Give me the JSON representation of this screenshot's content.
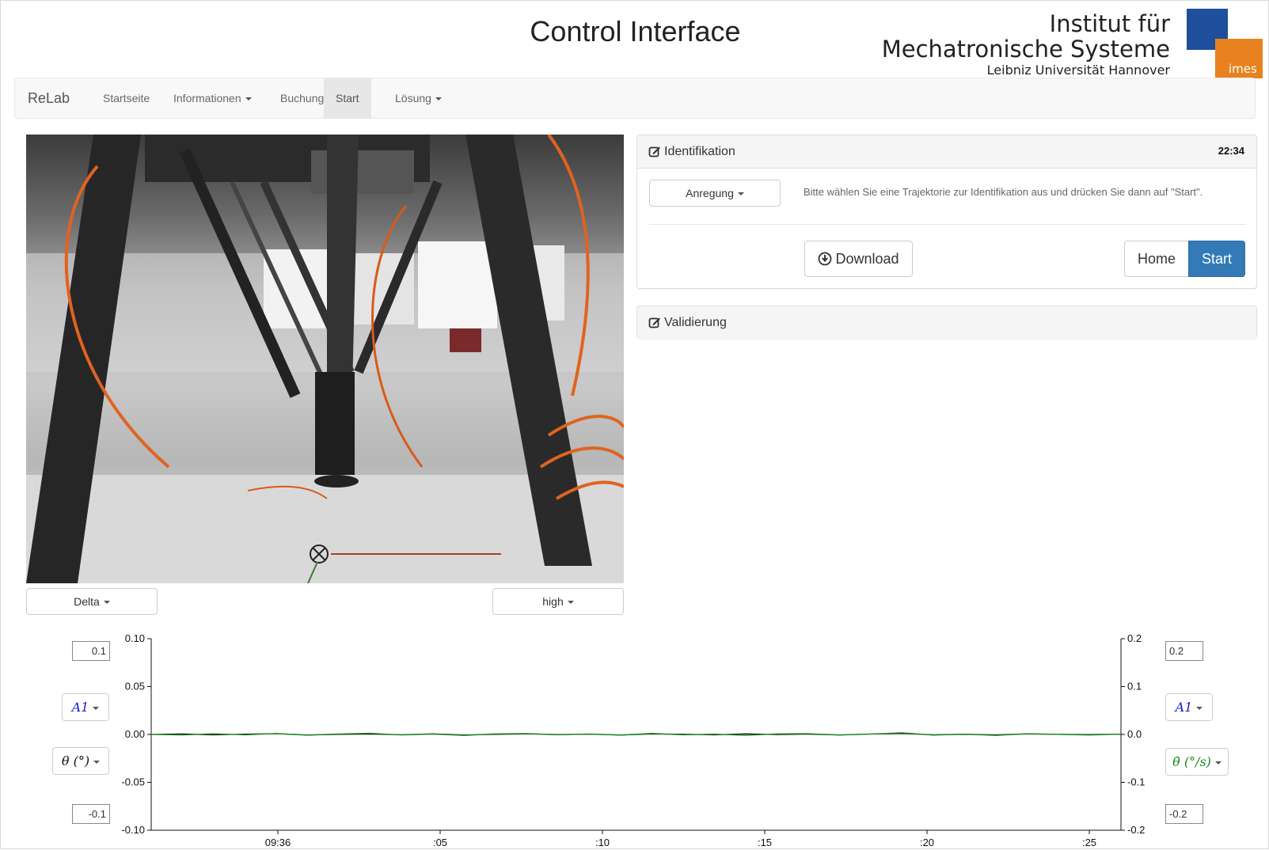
{
  "header": {
    "title": "Control Interface",
    "logo": {
      "line1": "Institut für",
      "line2": "Mechatronische Systeme",
      "line3": "Leibniz Universität Hannover",
      "badge": "imes",
      "colors": {
        "blue": "#1f4e9c",
        "orange": "#e8821e"
      }
    }
  },
  "navbar": {
    "brand": "ReLab",
    "items": [
      {
        "label": "Startseite",
        "dropdown": false,
        "active": false
      },
      {
        "label": "Informationen",
        "dropdown": true,
        "active": false
      },
      {
        "label": "Buchung",
        "dropdown": false,
        "active": false
      },
      {
        "label": "Start",
        "dropdown": false,
        "active": true
      },
      {
        "label": "Lösung",
        "dropdown": true,
        "active": false
      }
    ]
  },
  "camera": {
    "robot_select": "Delta",
    "quality_select": "high"
  },
  "identification_panel": {
    "title": "Identifikation",
    "icon": "edit-icon",
    "timer": "22:34",
    "excitation_select": "Anregung",
    "instruction": "Bitte wählen Sie eine Trajektorie zur Identifikation aus und drücken Sie dann auf \"Start\".",
    "download_label": "Download",
    "download_icon": "download-circle-icon",
    "home_label": "Home",
    "start_label": "Start",
    "accent": "#337ab7"
  },
  "validation_panel": {
    "title": "Validierung",
    "icon": "edit-icon"
  },
  "plot_controls": {
    "left_max": "0.1",
    "left_min": "-0.1",
    "right_max": "0.2",
    "right_min": "-0.2",
    "left_axis_select": "A1",
    "right_axis_select": "A1",
    "left_quantity": "θ (°)",
    "right_quantity": "θ̇ (°/s)",
    "left_quantity_color": "#111111",
    "right_quantity_color": "#1a8a1a",
    "axis_select_color": "#1a1acc"
  },
  "chart_data": {
    "type": "line",
    "x_tick_labels": [
      "09:36",
      ":05",
      ":10",
      ":15",
      ":20",
      ":25"
    ],
    "left_axis": {
      "ylim": [
        -0.1,
        0.1
      ],
      "ticks": [
        "0.10",
        "0.05",
        "0.00",
        "-0.05",
        "-0.10"
      ]
    },
    "right_axis": {
      "ylim": [
        -0.2,
        0.2
      ],
      "ticks": [
        "0.2",
        "0.1",
        "0.0",
        "-0.1",
        "-0.2"
      ]
    },
    "grid": false,
    "series": [
      {
        "color": "#111111",
        "axis": "left",
        "values": [
          0.0,
          0.0005,
          -0.0004,
          0.0003,
          0.0008,
          -0.0006,
          0.0002,
          0.0004,
          -0.0003,
          0.0006,
          -0.0005,
          0.0001,
          0.0007,
          -0.0002,
          0.0003,
          -0.0006,
          0.0005,
          0.0002,
          -0.0004,
          0.0006,
          -0.0001,
          0.0003,
          -0.0005,
          0.0004,
          0.0009,
          -0.0003,
          0.0002,
          -0.0004,
          0.0006,
          0.0001,
          -0.0002,
          0.0003
        ]
      },
      {
        "color": "#1a8a1a",
        "axis": "right",
        "values": [
          0.0,
          -0.001,
          0.0015,
          -0.0008,
          0.002,
          -0.0015,
          0.001,
          0.0025,
          -0.001,
          0.0008,
          -0.002,
          0.0012,
          0.0018,
          -0.0006,
          0.001,
          -0.0014,
          0.0022,
          -0.0009,
          0.0006,
          -0.0018,
          0.0011,
          0.0016,
          -0.0012,
          0.0009,
          0.0035,
          -0.0014,
          0.0007,
          -0.002,
          0.0015,
          0.0003,
          -0.0011,
          0.0006
        ]
      }
    ]
  }
}
